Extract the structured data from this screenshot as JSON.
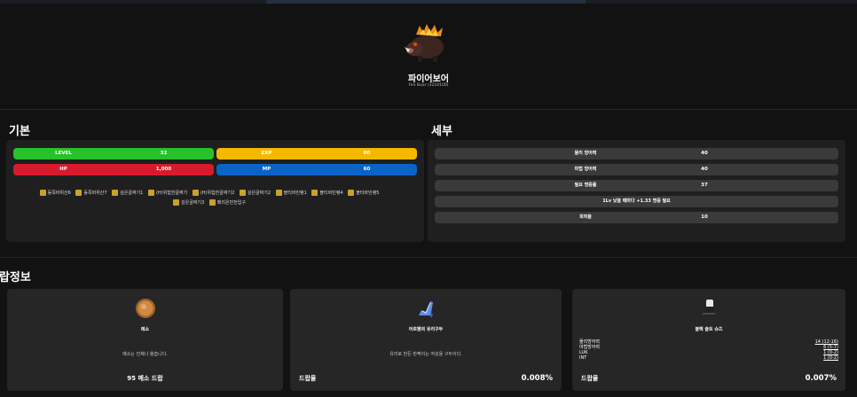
{
  "monster": {
    "name": "파이어보어",
    "sub": "Fire Boar (3210100)"
  },
  "basic": {
    "title": "기본",
    "level": {
      "label": "LEVEL",
      "value": "32",
      "color": "#27c229"
    },
    "exp": {
      "label": "EXP",
      "value": "60",
      "color": "#f5b800"
    },
    "hp": {
      "label": "HP",
      "value": "1,000",
      "color": "#d81b2c"
    },
    "mp": {
      "label": "MP",
      "value": "60",
      "color": "#0a64c8"
    },
    "maps": [
      "동쪽바위산6",
      "동쪽바위산7",
      "깊은골짜기1",
      "(H)위험한골짜기",
      "(H)위험한골짜기2",
      "깊은골짜기2",
      "블티바민랭1",
      "블티바민랭4",
      "블티바민랭5",
      "깊은골짜기3",
      "페리온민전입구"
    ]
  },
  "detail": {
    "title": "세부",
    "rows": [
      {
        "label": "물리 방어력",
        "value": "40"
      },
      {
        "label": "마법 방어력",
        "value": "40"
      },
      {
        "label": "필요 명중률",
        "value": "37"
      }
    ],
    "note": "1Lv 낮을 때마다 +1.33 명중 필요",
    "evasion": {
      "label": "회피율",
      "value": "10"
    }
  },
  "drops": {
    "title": "드랍정보",
    "cards": [
      {
        "name": "메소",
        "desc": "메소는 언제나 옳습니다.",
        "meso_text": "95 메소 드랍",
        "icon": "meso-coin-icon"
      },
      {
        "name": "어르웬의 유리구두",
        "desc": "유리로 만든 반짝이는 여성용 구두이다.",
        "drop_label": "드랍율",
        "rate": "0.008%",
        "icon": "glass-shoe-icon"
      },
      {
        "name": "블랙 숄트 슈즈",
        "stats": [
          {
            "label": "물리방어력",
            "value": "14 (12-16)"
          },
          {
            "label": "마법방어력",
            "value": "6 (5-7)"
          },
          {
            "label": "LUK",
            "value": "1 (0-2)"
          },
          {
            "label": "INT",
            "value": "1 (0-2)"
          }
        ],
        "drop_label": "드랍율",
        "rate": "0.007%",
        "icon": "black-shoe-icon"
      }
    ]
  }
}
